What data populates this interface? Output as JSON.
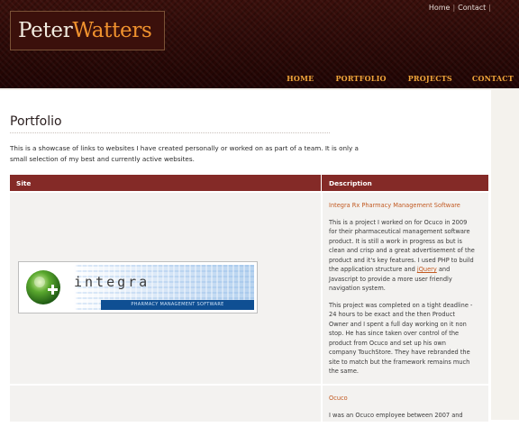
{
  "header": {
    "logo_first": "Peter",
    "logo_last": "Watters",
    "toplinks": [
      "Home",
      "Contact"
    ],
    "nav": [
      "HOME",
      "PORTFOLIO",
      "PROJECTS",
      "CONTACT"
    ]
  },
  "page": {
    "title": "Portfolio",
    "intro": "This is a showcase of links to websites I have created personally or worked on as part of a team. It is only a small selection of my best and currently active websites."
  },
  "table": {
    "headers": {
      "site": "Site",
      "description": "Description"
    },
    "rows": [
      {
        "title": "Integra Rx Pharmacy Management Software",
        "thumbnail": {
          "word": "integra",
          "band": "PHARMACY MANAGEMENT SOFTWARE"
        },
        "para1_before": "This is a project I worked on for Ocuco in 2009 for their pharmaceutical management software product. It is still a work in progress as but is clean and crisp and a great advertisement of the product and it's key features. I used PHP to build the application structure and ",
        "para1_link": "jQuery",
        "para1_after": " and Javascript to provide a more user friendly navigation system.",
        "para2": "This project was completed on a tight deadline - 24 hours to be exact and the then Product Owner and I spent a full day working on it non stop. He has since taken over control of the product from Ocuco and set up his own company TouchStore. They have rebranded the site to match but the framework remains much the same."
      },
      {
        "title": "Ocuco",
        "para1": "I was an Ocuco employee between 2007 and"
      }
    ]
  },
  "colors": {
    "header_bg": "#2b0806",
    "nav_link": "#f0a53a",
    "logo_accent": "#f0922e",
    "table_header": "#842a27",
    "link": "#c25a22"
  }
}
